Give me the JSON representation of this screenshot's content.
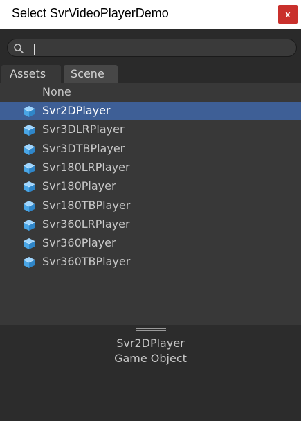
{
  "window": {
    "title": "Select SvrVideoPlayerDemo",
    "close_label": "x"
  },
  "search": {
    "value": "",
    "icon": "search-icon"
  },
  "tabs": [
    {
      "label": "Assets",
      "active": true
    },
    {
      "label": "Scene",
      "active": false
    }
  ],
  "list": {
    "none_label": "None",
    "selected_index": 0,
    "item_icon": "gameobject-cube-icon",
    "items": [
      {
        "label": "Svr2DPlayer"
      },
      {
        "label": "Svr3DLRPlayer"
      },
      {
        "label": "Svr3DTBPlayer"
      },
      {
        "label": "Svr180LRPlayer"
      },
      {
        "label": "Svr180Player"
      },
      {
        "label": "Svr180TBPlayer"
      },
      {
        "label": "Svr360LRPlayer"
      },
      {
        "label": "Svr360Player"
      },
      {
        "label": "Svr360TBPlayer"
      }
    ]
  },
  "preview": {
    "name": "Svr2DPlayer",
    "type": "Game Object"
  },
  "colors": {
    "close_button": "#c9302c",
    "selection": "#3e5f96",
    "panel_bg": "#383838"
  }
}
